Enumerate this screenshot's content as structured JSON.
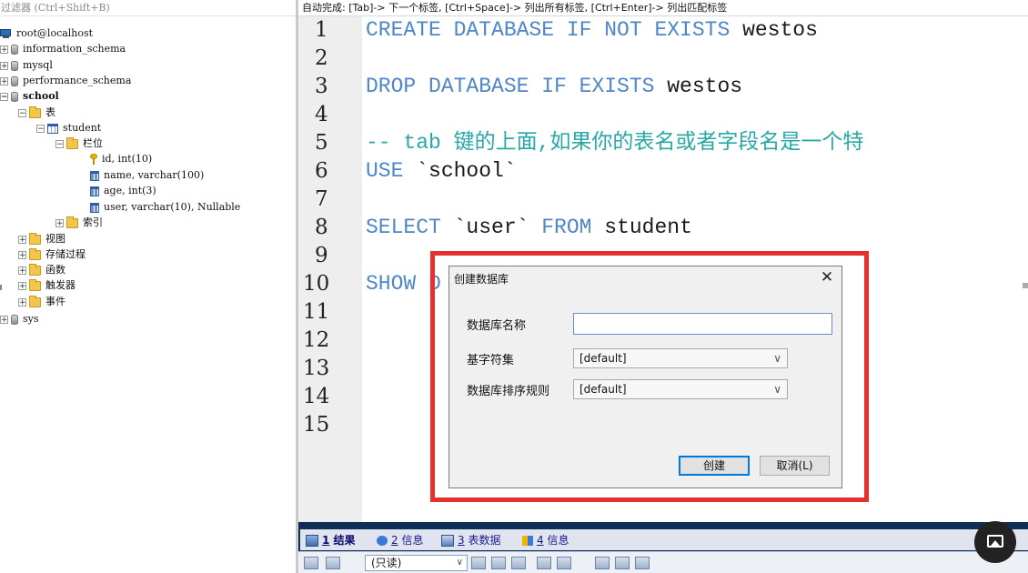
{
  "filter": {
    "placeholder": "过滤器 (Ctrl+Shift+B)"
  },
  "tree": {
    "host": "root@localhost",
    "databases": [
      "information_schema",
      "mysql",
      "performance_schema",
      "school",
      "sys"
    ],
    "school": {
      "tables_folder": "表",
      "table": "student",
      "columns_folder": "栏位",
      "columns": [
        "id, int(10)",
        "name, varchar(100)",
        "age, int(3)",
        "user, varchar(10), Nullable"
      ],
      "index_folder": "索引",
      "folders": [
        "视图",
        "存储过程",
        "函数",
        "触发器",
        "事件"
      ]
    },
    "expand_plus": "+",
    "expand_minus": "−"
  },
  "editor": {
    "hint": "自动完成: [Tab]-> 下一个标签, [Ctrl+Space]-> 列出所有标签, [Ctrl+Enter]-> 列出匹配标签",
    "line_numbers": [
      "1",
      "2",
      "3",
      "4",
      "5",
      "6",
      "7",
      "8",
      "9",
      "10",
      "11",
      "12",
      "13",
      "14",
      "15"
    ],
    "lines": {
      "l1_kw": "CREATE DATABASE IF NOT EXISTS",
      "l1_tx": " westos",
      "l3_kw": "DROP DATABASE IF EXISTS",
      "l3_tx": " westos",
      "l5_cm": "-- tab 键的上面,如果你的表名或者字段名是一个特",
      "l6_kw": "USE",
      "l6_tx": " `school`",
      "l8_kw1": "SELECT",
      "l8_tx1": " `user` ",
      "l8_kw2": "FROM",
      "l8_tx2": " student",
      "l10_kw": "SHOW D"
    }
  },
  "results": {
    "tabs": [
      {
        "num": "1",
        "label": "结果"
      },
      {
        "num": "2",
        "label": "信息"
      },
      {
        "num": "3",
        "label": "表数据"
      },
      {
        "num": "4",
        "label": "信息"
      }
    ],
    "readonly_select": "(只读)"
  },
  "dialog": {
    "title": "创建数据库",
    "close": "✕",
    "name_label": "数据库名称",
    "name_value": "",
    "charset_label": "基字符集",
    "charset_value": "[default]",
    "collation_label": "数据库排序规则",
    "collation_value": "[default]",
    "create_button": "创建",
    "cancel_button": "取消(L)"
  },
  "colors": {
    "keyword": "#4f86c8",
    "comment": "#2aa7a7",
    "highlight_box": "#e6302f",
    "results_bar": "#0f2e56"
  }
}
